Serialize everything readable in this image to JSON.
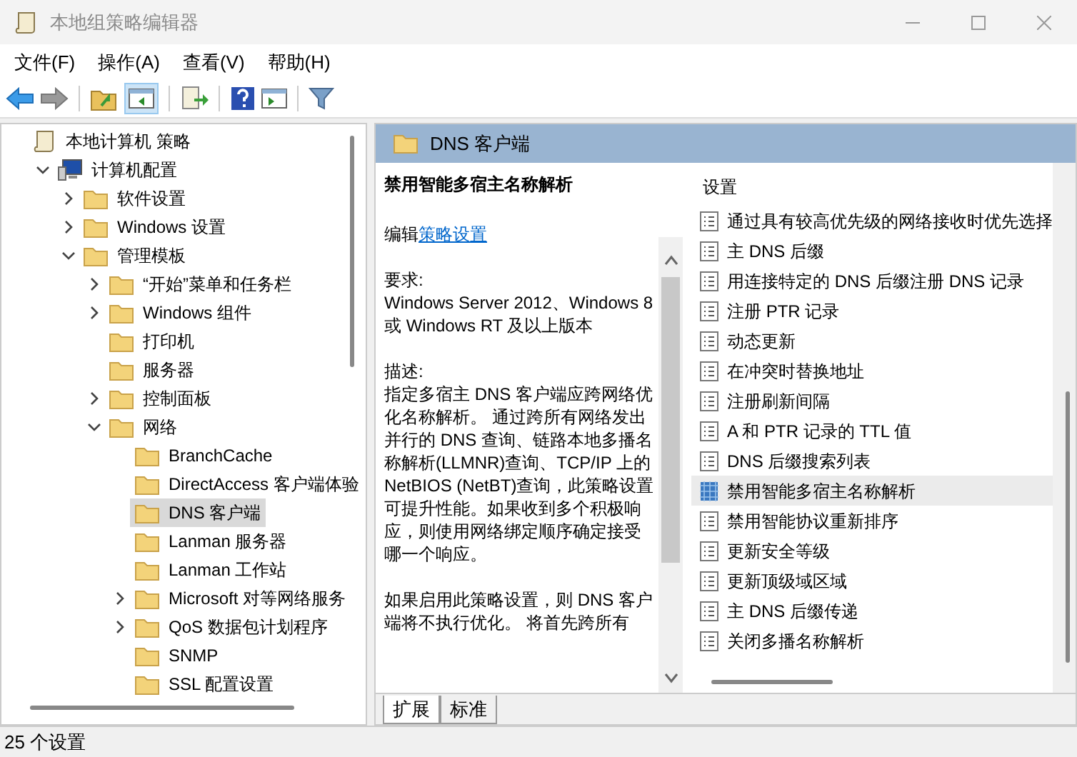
{
  "window": {
    "title": "本地组策略编辑器"
  },
  "menu": [
    "文件(F)",
    "操作(A)",
    "查看(V)",
    "帮助(H)"
  ],
  "tree": [
    {
      "label": "本地计算机 策略",
      "kind": "root",
      "children": [
        {
          "label": "计算机配置",
          "kind": "computer",
          "expanded": true,
          "children": [
            {
              "label": "软件设置",
              "kind": "folder",
              "expanded": false
            },
            {
              "label": "Windows 设置",
              "kind": "folder",
              "expanded": false
            },
            {
              "label": "管理模板",
              "kind": "folder",
              "expanded": true,
              "children": [
                {
                  "label": "“开始”菜单和任务栏",
                  "kind": "folder",
                  "expanded": false
                },
                {
                  "label": "Windows 组件",
                  "kind": "folder",
                  "expanded": false
                },
                {
                  "label": "打印机",
                  "kind": "folder"
                },
                {
                  "label": "服务器",
                  "kind": "folder"
                },
                {
                  "label": "控制面板",
                  "kind": "folder",
                  "expanded": false
                },
                {
                  "label": "网络",
                  "kind": "folder",
                  "expanded": true,
                  "children": [
                    {
                      "label": "BranchCache",
                      "kind": "folder"
                    },
                    {
                      "label": "DirectAccess 客户端体验",
                      "kind": "folder"
                    },
                    {
                      "label": "DNS 客户端",
                      "kind": "folder",
                      "selected": true
                    },
                    {
                      "label": "Lanman 服务器",
                      "kind": "folder"
                    },
                    {
                      "label": "Lanman 工作站",
                      "kind": "folder"
                    },
                    {
                      "label": "Microsoft 对等网络服务",
                      "kind": "folder",
                      "expanded": false
                    },
                    {
                      "label": "QoS 数据包计划程序",
                      "kind": "folder",
                      "expanded": false
                    },
                    {
                      "label": "SNMP",
                      "kind": "folder"
                    },
                    {
                      "label": "SSL 配置设置",
                      "kind": "folder"
                    }
                  ]
                }
              ]
            }
          ]
        }
      ]
    }
  ],
  "header": {
    "title": "DNS 客户端"
  },
  "description": {
    "title": "禁用智能多宿主名称解析",
    "edit_prefix": "编辑",
    "edit_link": "策略设置",
    "requirements_label": "要求:",
    "requirements": "Windows Server 2012、Windows 8 或 Windows RT 及以上版本",
    "description_label": "描述:",
    "paragraphs": [
      "指定多宿主 DNS 客户端应跨网络优化名称解析。 通过跨所有网络发出并行的 DNS 查询、链路本地多播名称解析(LLMNR)查询、TCP/IP 上的 NetBIOS (NetBT)查询，此策略设置可提升性能。如果收到多个积极响应，则使用网络绑定顺序确定接受哪一个响应。",
      "如果启用此策略设置，则 DNS 客户端将不执行优化。 将首先跨所有"
    ]
  },
  "settings": {
    "column": "设置",
    "items": [
      {
        "label": "通过具有较高优先级的网络接收时优先选择",
        "selected": false
      },
      {
        "label": "主 DNS 后缀",
        "selected": false
      },
      {
        "label": "用连接特定的 DNS 后缀注册 DNS 记录",
        "selected": false
      },
      {
        "label": "注册 PTR 记录",
        "selected": false
      },
      {
        "label": "动态更新",
        "selected": false
      },
      {
        "label": "在冲突时替换地址",
        "selected": false
      },
      {
        "label": "注册刷新间隔",
        "selected": false
      },
      {
        "label": "A 和 PTR 记录的 TTL 值",
        "selected": false
      },
      {
        "label": "DNS 后缀搜索列表",
        "selected": false
      },
      {
        "label": "禁用智能多宿主名称解析",
        "selected": true
      },
      {
        "label": "禁用智能协议重新排序",
        "selected": false
      },
      {
        "label": "更新安全等级",
        "selected": false
      },
      {
        "label": "更新顶级域区域",
        "selected": false
      },
      {
        "label": "主 DNS 后缀传递",
        "selected": false
      },
      {
        "label": "关闭多播名称解析",
        "selected": false
      }
    ]
  },
  "tabs": [
    {
      "label": "扩展",
      "selected": true
    },
    {
      "label": "标准",
      "selected": false
    }
  ],
  "status_bar": "25 个设置"
}
